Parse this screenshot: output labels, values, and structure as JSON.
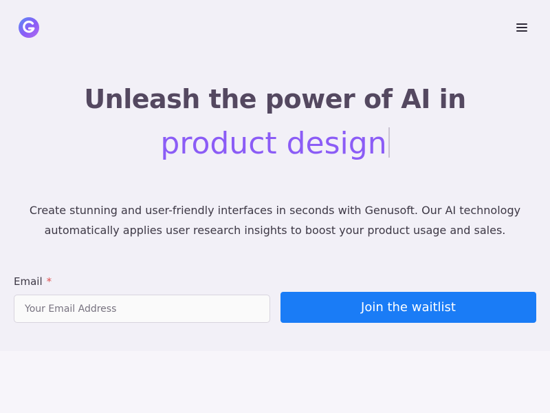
{
  "header": {
    "logo_icon": "g-logo-icon",
    "menu_icon": "hamburger-menu-icon"
  },
  "hero": {
    "headline": "Unleash the power of AI in",
    "typed_text": "product design",
    "description": "Create stunning and user-friendly interfaces in seconds with Genusoft. Our AI technology automatically applies user research insights to boost your product usage and sales."
  },
  "form": {
    "email_label": "Email",
    "required_mark": "*",
    "email_value": "",
    "email_placeholder": "Your Email Address",
    "submit_label": "Join the waitlist"
  },
  "colors": {
    "accent_purple": "#8b5cf6",
    "button_blue": "#1a7cf6",
    "headline": "#544860",
    "hero_background": "#f2f0f7"
  }
}
